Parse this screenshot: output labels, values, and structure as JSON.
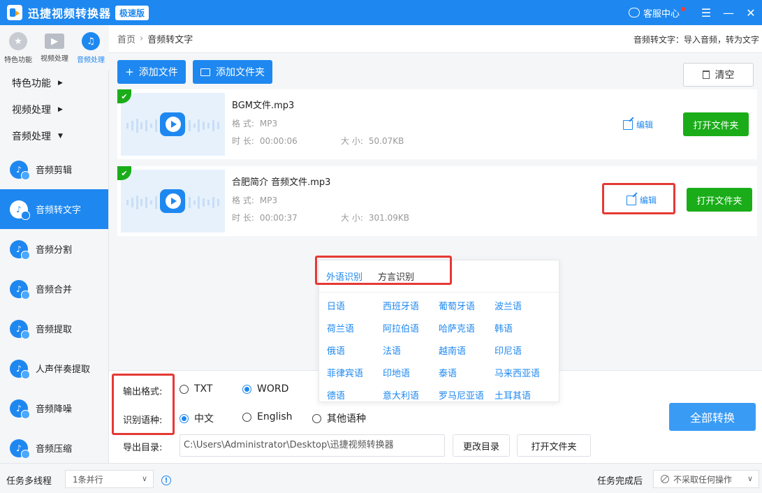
{
  "titlebar": {
    "title": "迅捷视频转换器",
    "badge": "极速版",
    "service": "客服中心",
    "menu_icon": "menu-icon",
    "minimize_icon": "minimize-icon",
    "close_icon": "close-icon"
  },
  "left_tabs": [
    {
      "label": "特色功能",
      "icon": "star-icon"
    },
    {
      "label": "视频处理",
      "icon": "film-icon"
    },
    {
      "label": "音频处理",
      "icon": "music-icon"
    }
  ],
  "sidebar": {
    "categories": [
      "特色功能",
      "视频处理",
      "音频处理"
    ],
    "items": [
      {
        "label": "音频剪辑"
      },
      {
        "label": "音频转文字"
      },
      {
        "label": "音频分割"
      },
      {
        "label": "音频合并"
      },
      {
        "label": "音频提取"
      },
      {
        "label": "人声伴奏提取"
      },
      {
        "label": "音频降噪"
      },
      {
        "label": "音频压缩"
      }
    ]
  },
  "breadcrumb": {
    "home": "首页",
    "current": "音频转文字",
    "tip": "音频转文字：导入音频，转为文字"
  },
  "toolbar": {
    "add_file": "添加文件",
    "add_folder": "添加文件夹",
    "clear": "清空"
  },
  "files": [
    {
      "name": "BGM文件.mp3",
      "format_label": "格  式:",
      "format": "MP3",
      "duration_label": "时  长:",
      "duration": "00:00:06",
      "size_label": "大  小:",
      "size": "50.07KB",
      "edit": "编辑",
      "open_folder": "打开文件夹"
    },
    {
      "name": "合肥简介 音频文件.mp3",
      "format_label": "格  式:",
      "format": "MP3",
      "duration_label": "时  长:",
      "duration": "00:00:37",
      "size_label": "大  小:",
      "size": "301.09KB",
      "edit": "编辑",
      "open_folder": "打开文件夹"
    }
  ],
  "language_popup": {
    "tabs": [
      "外语识别",
      "方言识别"
    ],
    "languages": [
      "日语",
      "西班牙语",
      "葡萄牙语",
      "波兰语",
      "荷兰语",
      "阿拉伯语",
      "哈萨克语",
      "韩语",
      "俄语",
      "法语",
      "越南语",
      "印尼语",
      "菲律宾语",
      "印地语",
      "泰语",
      "马来西亚语",
      "德语",
      "意大利语",
      "罗马尼亚语",
      "土耳其语"
    ]
  },
  "settings": {
    "output_format_label": "输出格式:",
    "format_txt": "TXT",
    "format_word": "WORD",
    "language_label": "识别语种:",
    "lang_chinese": "中文",
    "lang_english": "English",
    "lang_other": "其他语种",
    "output_dir_label": "导出目录:",
    "output_dir": "C:\\Users\\Administrator\\Desktop\\迅捷视频转换器",
    "change_dir": "更改目录",
    "open_folder": "打开文件夹",
    "convert_all": "全部转换"
  },
  "footer": {
    "threads_label": "任务多线程",
    "threads_value": "1条并行",
    "after_label": "任务完成后",
    "after_value": "不采取任何操作"
  },
  "colors": {
    "accent": "#1e88f0",
    "success": "#1aad19",
    "highlight": "#e53935"
  }
}
